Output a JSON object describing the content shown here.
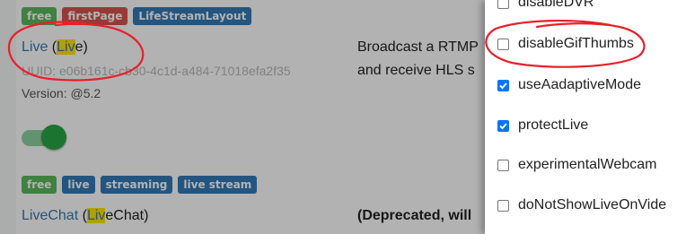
{
  "top_tags": [
    {
      "label": "free",
      "color": "#5cb85c"
    },
    {
      "label": "firstPage",
      "color": "#d9534f"
    },
    {
      "label": "LifeStreamLayout",
      "color": "#337ab7"
    }
  ],
  "live_card": {
    "title_prefix": "Live",
    "title_open": " (",
    "title_highlight": "Liv",
    "title_rest": "e)",
    "uuid": "UUID: e06b161c-cb30-4c1d-a484-71018efa2f35",
    "version": "Version: @5.2",
    "toggle_on": true,
    "description_line1": "Broadcast a RTMP",
    "description_line2": "and receive HLS s"
  },
  "bottom_tags": [
    {
      "label": "free",
      "color": "#5cb85c"
    },
    {
      "label": "live",
      "color": "#337ab7"
    },
    {
      "label": "streaming",
      "color": "#337ab7"
    },
    {
      "label": "live stream",
      "color": "#337ab7"
    }
  ],
  "livechat_card": {
    "title_prefix": "LiveChat",
    "title_open": " (",
    "title_highlight": "Liv",
    "title_rest": "eChat)",
    "description_line1": "(Deprecated, will"
  },
  "options_panel": {
    "options": [
      {
        "label": "disableDVR",
        "checked": false
      },
      {
        "label": "disableGifThumbs",
        "checked": false
      },
      {
        "label": "useAadaptiveMode",
        "checked": true
      },
      {
        "label": "protectLive",
        "checked": true
      },
      {
        "label": "experimentalWebcam",
        "checked": false
      },
      {
        "label": "doNotShowLiveOnVide",
        "checked": false
      }
    ]
  },
  "colors": {
    "annotation_red": "#e8202a",
    "link_blue": "#337ab7",
    "highlight": "#ffe400",
    "checkbox_blue": "#0075ff",
    "toggle_green": "#28a745"
  }
}
